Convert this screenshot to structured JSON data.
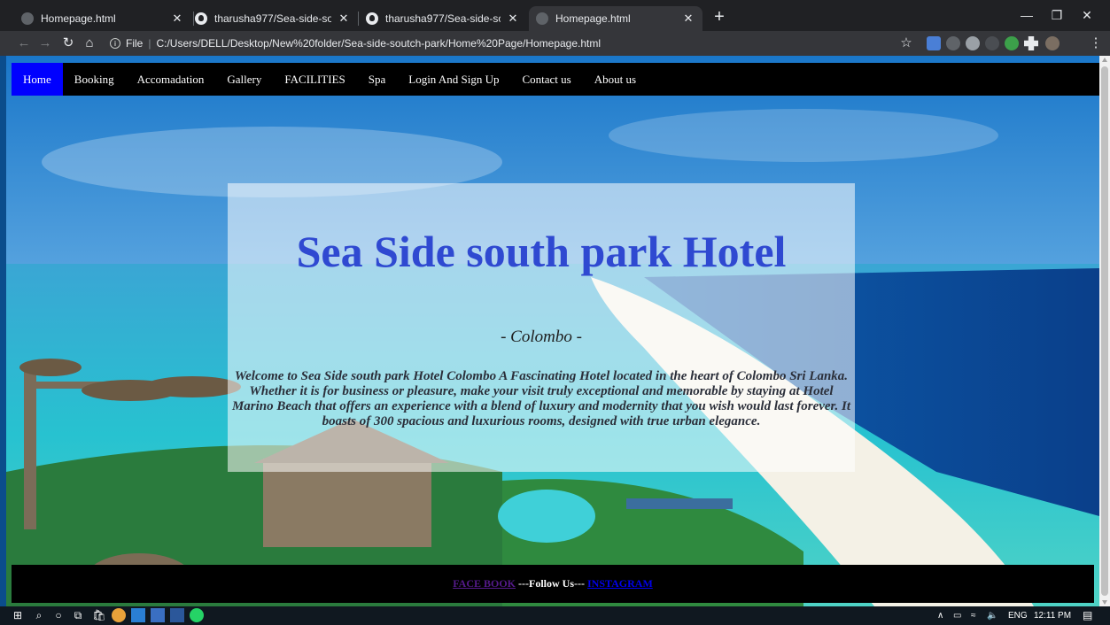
{
  "browser": {
    "tabs": [
      {
        "title": "Homepage.html",
        "active": false
      },
      {
        "title": "tharusha977/Sea-side-soutch-pa",
        "active": false
      },
      {
        "title": "tharusha977/Sea-side-soutch-pa",
        "active": false
      },
      {
        "title": "Homepage.html",
        "active": true
      }
    ],
    "address": {
      "scheme_label": "File",
      "url": "C:/Users/DELL/Desktop/New%20folder/Sea-side-soutch-park/Home%20Page/Homepage.html"
    }
  },
  "site": {
    "nav": [
      "Home",
      "Booking",
      "Accomadation",
      "Gallery",
      "FACILITIES",
      "Spa",
      "Login And Sign Up",
      "Contact us",
      "About us"
    ],
    "active_nav": "Home",
    "hero": {
      "title": "Sea Side south park Hotel",
      "location": "- Colombo -",
      "intro": "Welcome to Sea Side south park Hotel Colombo A Fascinating Hotel located in the heart of Colombo Sri Lanka. Whether it is for business or pleasure, make your visit truly exceptional and memorable by staying at Hotel Marino Beach that offers an experience with a blend of luxury and modernity that you wish would last forever. It boasts of 300 spacious and luxurious rooms, designed with true urban elegance."
    },
    "footer": {
      "facebook_link": "FACE BOOK",
      "follow_text": "---Follow Us---",
      "instagram_link": "INSTAGRAM"
    }
  },
  "taskbar": {
    "language": "ENG",
    "time": "12:11 PM"
  },
  "colors": {
    "nav_active": "#0000ff",
    "hero_title": "#2f49d1",
    "chrome_dark": "#202124",
    "chrome_toolbar": "#35363a"
  }
}
